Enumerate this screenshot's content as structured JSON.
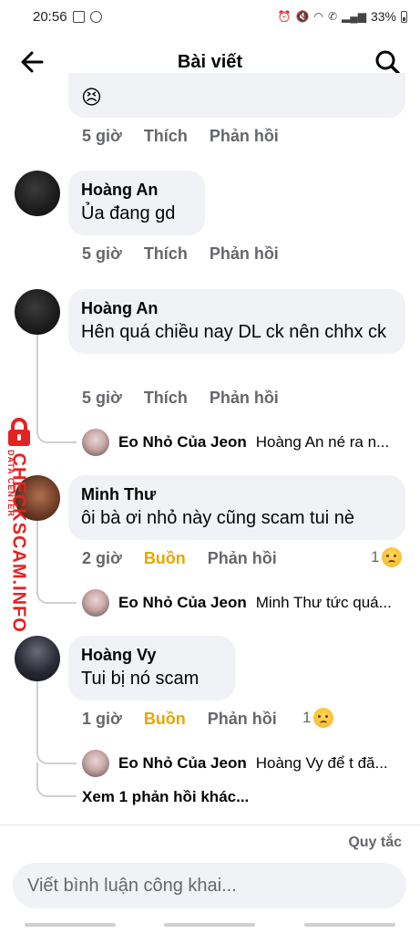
{
  "status_bar": {
    "time": "20:56",
    "battery": "33%"
  },
  "header": {
    "title": "Bài viết"
  },
  "top_comment": {
    "emoji": "😣",
    "time": "5 giờ",
    "like": "Thích",
    "reply": "Phản hồi"
  },
  "comments": [
    {
      "author": "Hoàng An",
      "text": "Ủa đang gd",
      "time": "5 giờ",
      "like": "Thích",
      "reply": "Phản hồi"
    },
    {
      "author": "Hoàng An",
      "text": "Hên quá chiều nay DL ck nên chhx ck",
      "time": "5 giờ",
      "like": "Thích",
      "reply": "Phản hồi",
      "reply_preview": {
        "name": "Eo Nhỏ Của Jeon",
        "text": "Hoàng An né ra n..."
      }
    },
    {
      "author": "Minh Thư",
      "text": "ôi bà ơi nhỏ này cũng scam tui nè",
      "time": "2 giờ",
      "like": "Buồn",
      "reply": "Phản hồi",
      "reaction_count": "1",
      "reply_preview": {
        "name": "Eo Nhỏ Của Jeon",
        "text": "Minh Thư tức quá..."
      }
    },
    {
      "author": "Hoàng Vy",
      "text": "Tui bị nó scam",
      "time": "1 giờ",
      "like": "Buồn",
      "reply": "Phản hồi",
      "reaction_count": "1",
      "reply_preview": {
        "name": "Eo Nhỏ Của Jeon",
        "text": "Hoàng Vy để t đă..."
      },
      "more_replies": "Xem 1 phản hồi khác..."
    }
  ],
  "watermark": {
    "main": "CHECKSCAM.INFO",
    "sub": "DATA CENTER"
  },
  "footer": {
    "rules": "Quy tắc",
    "input_placeholder": "Viết bình luận công khai..."
  },
  "colors": {
    "reaction_sad": "#e7a600",
    "watermark": "#e52222"
  }
}
